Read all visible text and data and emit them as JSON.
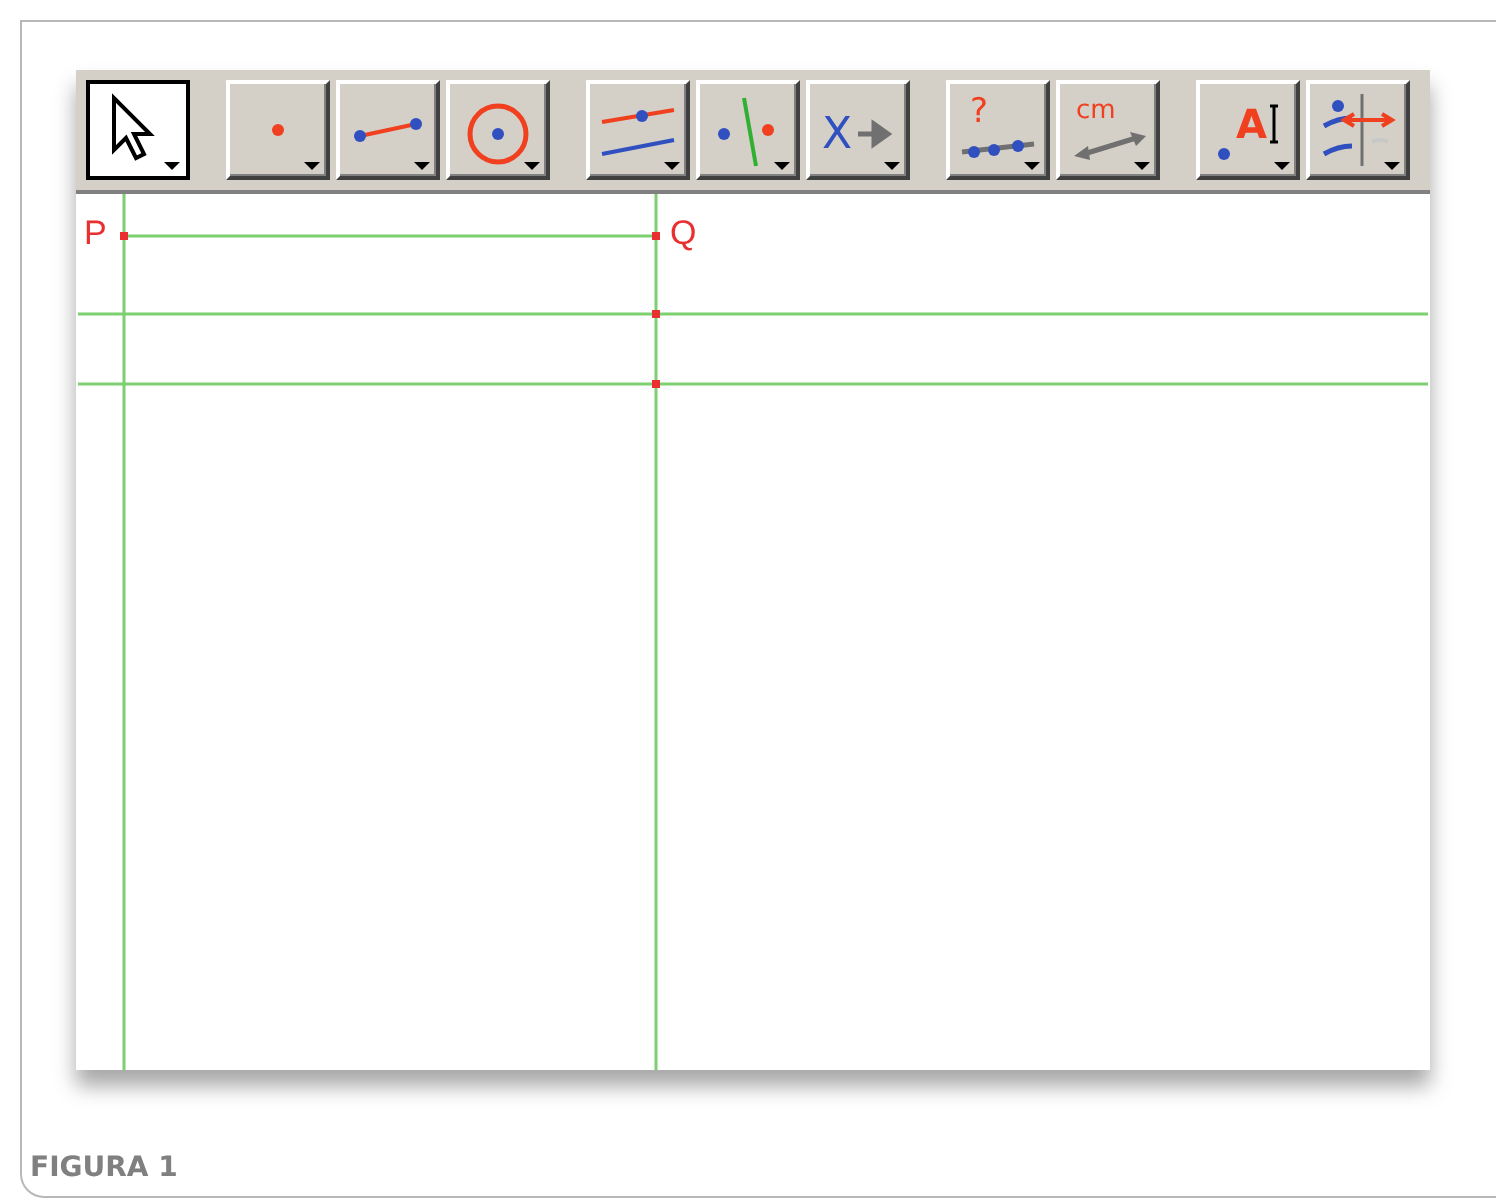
{
  "toolbar": {
    "groups": [
      {
        "buttons": [
          {
            "kind": "pointer",
            "selected": true
          }
        ]
      },
      {
        "buttons": [
          {
            "kind": "point",
            "selected": false
          },
          {
            "kind": "segment",
            "selected": false
          },
          {
            "kind": "circle",
            "selected": false
          }
        ]
      },
      {
        "buttons": [
          {
            "kind": "parallel",
            "selected": false
          },
          {
            "kind": "perpendicular",
            "selected": false
          },
          {
            "kind": "transform",
            "selected": false,
            "glyph": "X"
          }
        ]
      },
      {
        "buttons": [
          {
            "kind": "query",
            "selected": false,
            "glyph": "?"
          },
          {
            "kind": "measure",
            "selected": false,
            "glyph": "cm"
          }
        ]
      },
      {
        "buttons": [
          {
            "kind": "label",
            "selected": false,
            "glyph": "A"
          },
          {
            "kind": "display",
            "selected": false
          }
        ]
      }
    ]
  },
  "canvas": {
    "point_labels": [
      "P",
      "Q"
    ]
  },
  "caption": "FIGURA 1"
}
